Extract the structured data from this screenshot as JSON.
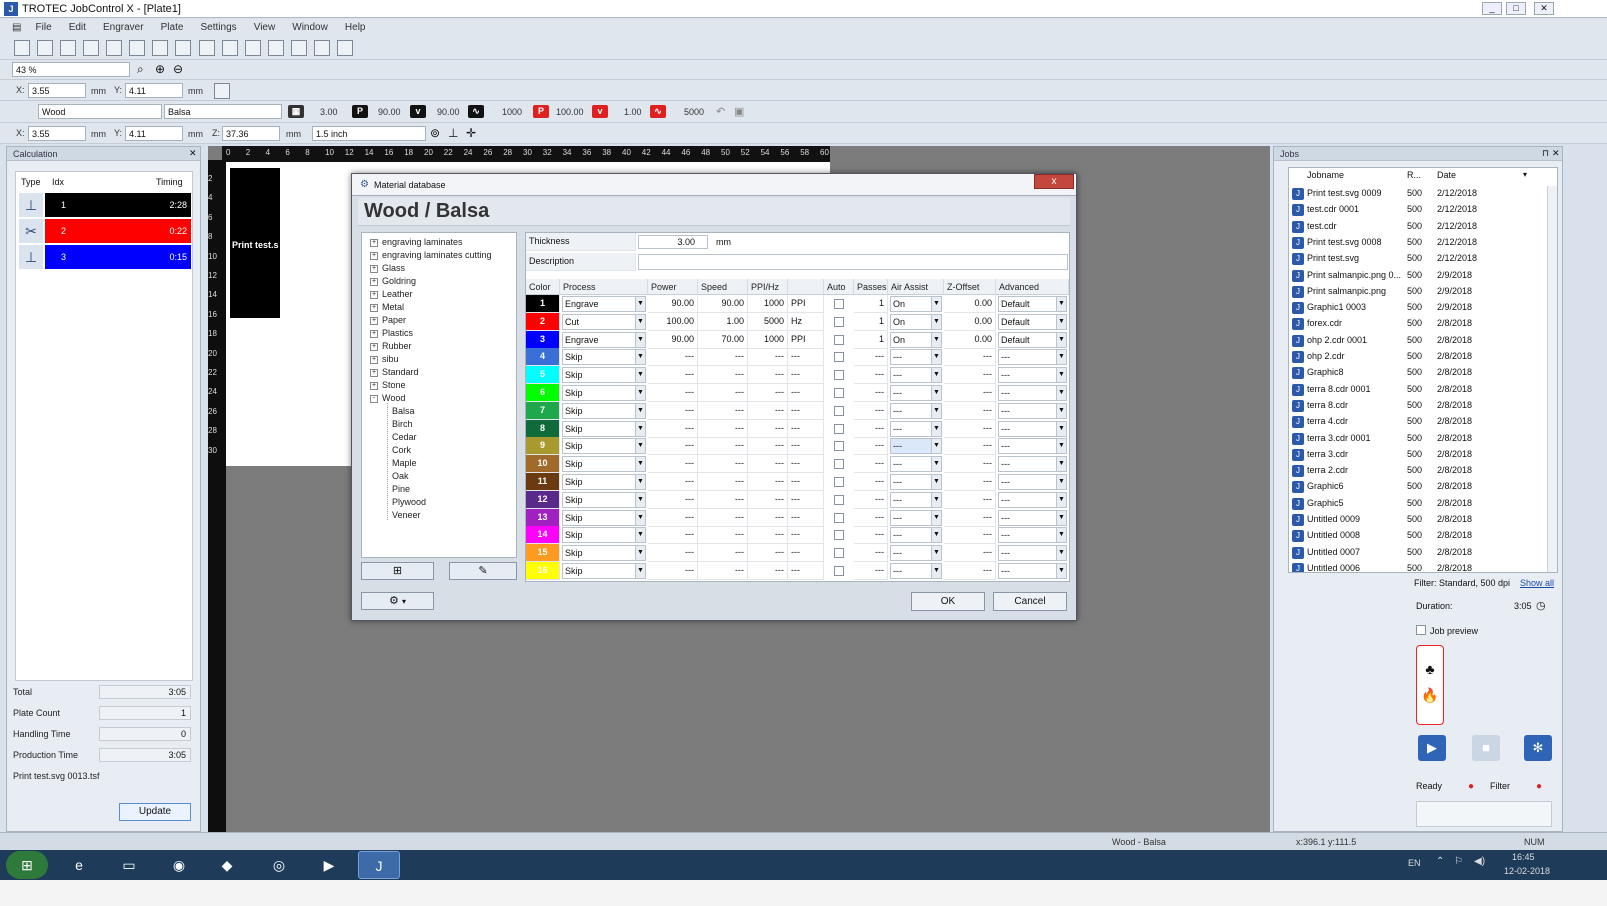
{
  "window": {
    "title": "TROTEC JobControl X - [Plate1]"
  },
  "menu": [
    "File",
    "Edit",
    "Engraver",
    "Plate",
    "Settings",
    "View",
    "Window",
    "Help"
  ],
  "toolbar": {
    "zoom": "43 %",
    "x1_label": "X:",
    "x1": "3.55",
    "unit_mm": "mm",
    "y1_label": "Y:",
    "y1": "4.11",
    "material": "Wood",
    "submaterial": "Balsa",
    "thick": "3.00",
    "power": "90.00",
    "speed": "90.00",
    "ppi": "1000",
    "power2": "100.00",
    "speed2": "1.00",
    "freq": "5000",
    "x2": "3.55",
    "y2": "4.11",
    "z_label": "Z:",
    "z": "37.36",
    "lens": "1.5 inch"
  },
  "calculation": {
    "title": "Calculation",
    "headers": {
      "type": "Type",
      "idx": "Idx",
      "timing": "Timing"
    },
    "rows": [
      {
        "idx": "1",
        "timing": "2:28",
        "color": "#000000"
      },
      {
        "idx": "2",
        "timing": "0:22",
        "color": "#ff0000"
      },
      {
        "idx": "3",
        "timing": "0:15",
        "color": "#0000ff"
      }
    ],
    "total_label": "Total",
    "total": "3:05",
    "plate_count_label": "Plate Count",
    "plate_count": "1",
    "handling_label": "Handling Time",
    "handling": "0",
    "production_label": "Production Time",
    "production": "3:05",
    "file": "Print test.svg 0013.tsf",
    "update": "Update"
  },
  "ruler": [
    "0",
    "2",
    "4",
    "6",
    "8",
    "10",
    "12",
    "14",
    "16",
    "18",
    "20",
    "22",
    "24",
    "26",
    "28",
    "30",
    "32",
    "34",
    "36",
    "38",
    "40",
    "42",
    "44",
    "46",
    "48",
    "50",
    "52",
    "54",
    "56",
    "58",
    "60"
  ],
  "ruler_v": [
    "2",
    "4",
    "6",
    "8",
    "10",
    "12",
    "14",
    "16",
    "18",
    "20",
    "22",
    "24",
    "26",
    "28",
    "30"
  ],
  "plate": {
    "job_label": "Print test.s"
  },
  "dialog": {
    "title": "Material database",
    "close": "x",
    "header": "Wood / Balsa",
    "tree": [
      {
        "label": "engraving laminates",
        "pm": "+"
      },
      {
        "label": "engraving laminates cutting",
        "pm": "+"
      },
      {
        "label": "Glass",
        "pm": "+"
      },
      {
        "label": "Goldring",
        "pm": "+"
      },
      {
        "label": "Leather",
        "pm": "+"
      },
      {
        "label": "Metal",
        "pm": "+"
      },
      {
        "label": "Paper",
        "pm": "+"
      },
      {
        "label": "Plastics",
        "pm": "+"
      },
      {
        "label": "Rubber",
        "pm": "+"
      },
      {
        "label": "sibu",
        "pm": "+"
      },
      {
        "label": "Standard",
        "pm": "+"
      },
      {
        "label": "Stone",
        "pm": "+"
      },
      {
        "label": "Wood",
        "pm": "-"
      }
    ],
    "tree_children": [
      "Balsa",
      "Birch",
      "Cedar",
      "Cork",
      "Maple",
      "Oak",
      "Pine",
      "Plywood",
      "Veneer"
    ],
    "thickness_label": "Thickness",
    "thickness": "3.00",
    "thickness_unit": "mm",
    "description_label": "Description",
    "headers": [
      "Color",
      "Process",
      "Power",
      "Speed",
      "PPI/Hz",
      "",
      "Auto",
      "Passes",
      "Air Assist",
      "Z-Offset",
      "Advanced"
    ],
    "rows": [
      {
        "n": "1",
        "color": "#000000",
        "process": "Engrave",
        "power": "90.00",
        "speed": "90.00",
        "ppi": "1000",
        "unit": "PPI",
        "passes": "1",
        "air": "On",
        "z": "0.00",
        "adv": "Default"
      },
      {
        "n": "2",
        "color": "#ff0000",
        "process": "Cut",
        "power": "100.00",
        "speed": "1.00",
        "ppi": "5000",
        "unit": "Hz",
        "passes": "1",
        "air": "On",
        "z": "0.00",
        "adv": "Default"
      },
      {
        "n": "3",
        "color": "#0000ff",
        "process": "Engrave",
        "power": "90.00",
        "speed": "70.00",
        "ppi": "1000",
        "unit": "PPI",
        "passes": "1",
        "air": "On",
        "z": "0.00",
        "adv": "Default"
      },
      {
        "n": "4",
        "color": "#3a6fd8",
        "process": "Skip",
        "power": "---",
        "speed": "---",
        "ppi": "---",
        "unit": "---",
        "passes": "---",
        "air": "---",
        "z": "---",
        "adv": "---"
      },
      {
        "n": "5",
        "color": "#00ffff",
        "process": "Skip",
        "power": "---",
        "speed": "---",
        "ppi": "---",
        "unit": "---",
        "passes": "---",
        "air": "---",
        "z": "---",
        "adv": "---"
      },
      {
        "n": "6",
        "color": "#00ff00",
        "process": "Skip",
        "power": "---",
        "speed": "---",
        "ppi": "---",
        "unit": "---",
        "passes": "---",
        "air": "---",
        "z": "---",
        "adv": "---"
      },
      {
        "n": "7",
        "color": "#1fa84b",
        "process": "Skip",
        "power": "---",
        "speed": "---",
        "ppi": "---",
        "unit": "---",
        "passes": "---",
        "air": "---",
        "z": "---",
        "adv": "---"
      },
      {
        "n": "8",
        "color": "#0f6b3a",
        "process": "Skip",
        "power": "---",
        "speed": "---",
        "ppi": "---",
        "unit": "---",
        "passes": "---",
        "air": "---",
        "z": "---",
        "adv": "---"
      },
      {
        "n": "9",
        "color": "#a89a2e",
        "process": "Skip",
        "power": "---",
        "speed": "---",
        "ppi": "---",
        "unit": "---",
        "passes": "---",
        "air": "---",
        "z": "---",
        "adv": "---"
      },
      {
        "n": "10",
        "color": "#a06b2a",
        "process": "Skip",
        "power": "---",
        "speed": "---",
        "ppi": "---",
        "unit": "---",
        "passes": "---",
        "air": "---",
        "z": "---",
        "adv": "---"
      },
      {
        "n": "11",
        "color": "#6b3a10",
        "process": "Skip",
        "power": "---",
        "speed": "---",
        "ppi": "---",
        "unit": "---",
        "passes": "---",
        "air": "---",
        "z": "---",
        "adv": "---"
      },
      {
        "n": "12",
        "color": "#5a2a8a",
        "process": "Skip",
        "power": "---",
        "speed": "---",
        "ppi": "---",
        "unit": "---",
        "passes": "---",
        "air": "---",
        "z": "---",
        "adv": "---"
      },
      {
        "n": "13",
        "color": "#a020c0",
        "process": "Skip",
        "power": "---",
        "speed": "---",
        "ppi": "---",
        "unit": "---",
        "passes": "---",
        "air": "---",
        "z": "---",
        "adv": "---"
      },
      {
        "n": "14",
        "color": "#ff00ff",
        "process": "Skip",
        "power": "---",
        "speed": "---",
        "ppi": "---",
        "unit": "---",
        "passes": "---",
        "air": "---",
        "z": "---",
        "adv": "---"
      },
      {
        "n": "15",
        "color": "#ff9a20",
        "process": "Skip",
        "power": "---",
        "speed": "---",
        "ppi": "---",
        "unit": "---",
        "passes": "---",
        "air": "---",
        "z": "---",
        "adv": "---"
      },
      {
        "n": "16",
        "color": "#ffff00",
        "process": "Skip",
        "power": "---",
        "speed": "---",
        "ppi": "---",
        "unit": "---",
        "passes": "---",
        "air": "---",
        "z": "---",
        "adv": "---"
      }
    ],
    "ok": "OK",
    "cancel": "Cancel"
  },
  "jobs": {
    "title": "Jobs",
    "headers": {
      "name": "Jobname",
      "res": "R...",
      "date": "Date"
    },
    "items": [
      {
        "name": "Print test.svg 0009",
        "res": "500",
        "date": "2/12/2018"
      },
      {
        "name": "test.cdr 0001",
        "res": "500",
        "date": "2/12/2018"
      },
      {
        "name": "test.cdr",
        "res": "500",
        "date": "2/12/2018"
      },
      {
        "name": "Print test.svg 0008",
        "res": "500",
        "date": "2/12/2018"
      },
      {
        "name": "Print test.svg",
        "res": "500",
        "date": "2/12/2018"
      },
      {
        "name": "Print salmanpic.png 0...",
        "res": "500",
        "date": "2/9/2018"
      },
      {
        "name": "Print salmanpic.png",
        "res": "500",
        "date": "2/9/2018"
      },
      {
        "name": "Graphic1 0003",
        "res": "500",
        "date": "2/9/2018"
      },
      {
        "name": "forex.cdr",
        "res": "500",
        "date": "2/8/2018"
      },
      {
        "name": "ohp 2.cdr 0001",
        "res": "500",
        "date": "2/8/2018"
      },
      {
        "name": "ohp 2.cdr",
        "res": "500",
        "date": "2/8/2018"
      },
      {
        "name": "Graphic8",
        "res": "500",
        "date": "2/8/2018"
      },
      {
        "name": "terra 8.cdr 0001",
        "res": "500",
        "date": "2/8/2018"
      },
      {
        "name": "terra 8.cdr",
        "res": "500",
        "date": "2/8/2018"
      },
      {
        "name": "terra 4.cdr",
        "res": "500",
        "date": "2/8/2018"
      },
      {
        "name": "terra 3.cdr 0001",
        "res": "500",
        "date": "2/8/2018"
      },
      {
        "name": "terra 3.cdr",
        "res": "500",
        "date": "2/8/2018"
      },
      {
        "name": "terra 2.cdr",
        "res": "500",
        "date": "2/8/2018"
      },
      {
        "name": "Graphic6",
        "res": "500",
        "date": "2/8/2018"
      },
      {
        "name": "Graphic5",
        "res": "500",
        "date": "2/8/2018"
      },
      {
        "name": "Untitled 0009",
        "res": "500",
        "date": "2/8/2018"
      },
      {
        "name": "Untitled 0008",
        "res": "500",
        "date": "2/8/2018"
      },
      {
        "name": "Untitled 0007",
        "res": "500",
        "date": "2/8/2018"
      },
      {
        "name": "Untitled 0006",
        "res": "500",
        "date": "2/8/2018"
      }
    ],
    "filter_text": "Filter: Standard, 500 dpi",
    "show_all": "Show all",
    "duration_label": "Duration:",
    "duration": "3:05",
    "job_preview": "Job preview",
    "ready": "Ready",
    "filter": "Filter"
  },
  "status": {
    "material": "Wood - Balsa",
    "coords": "x:396.1  y:111.5",
    "num": "NUM"
  },
  "tray": {
    "lang": "EN",
    "time": "16:45",
    "date": "12-02-2018"
  }
}
